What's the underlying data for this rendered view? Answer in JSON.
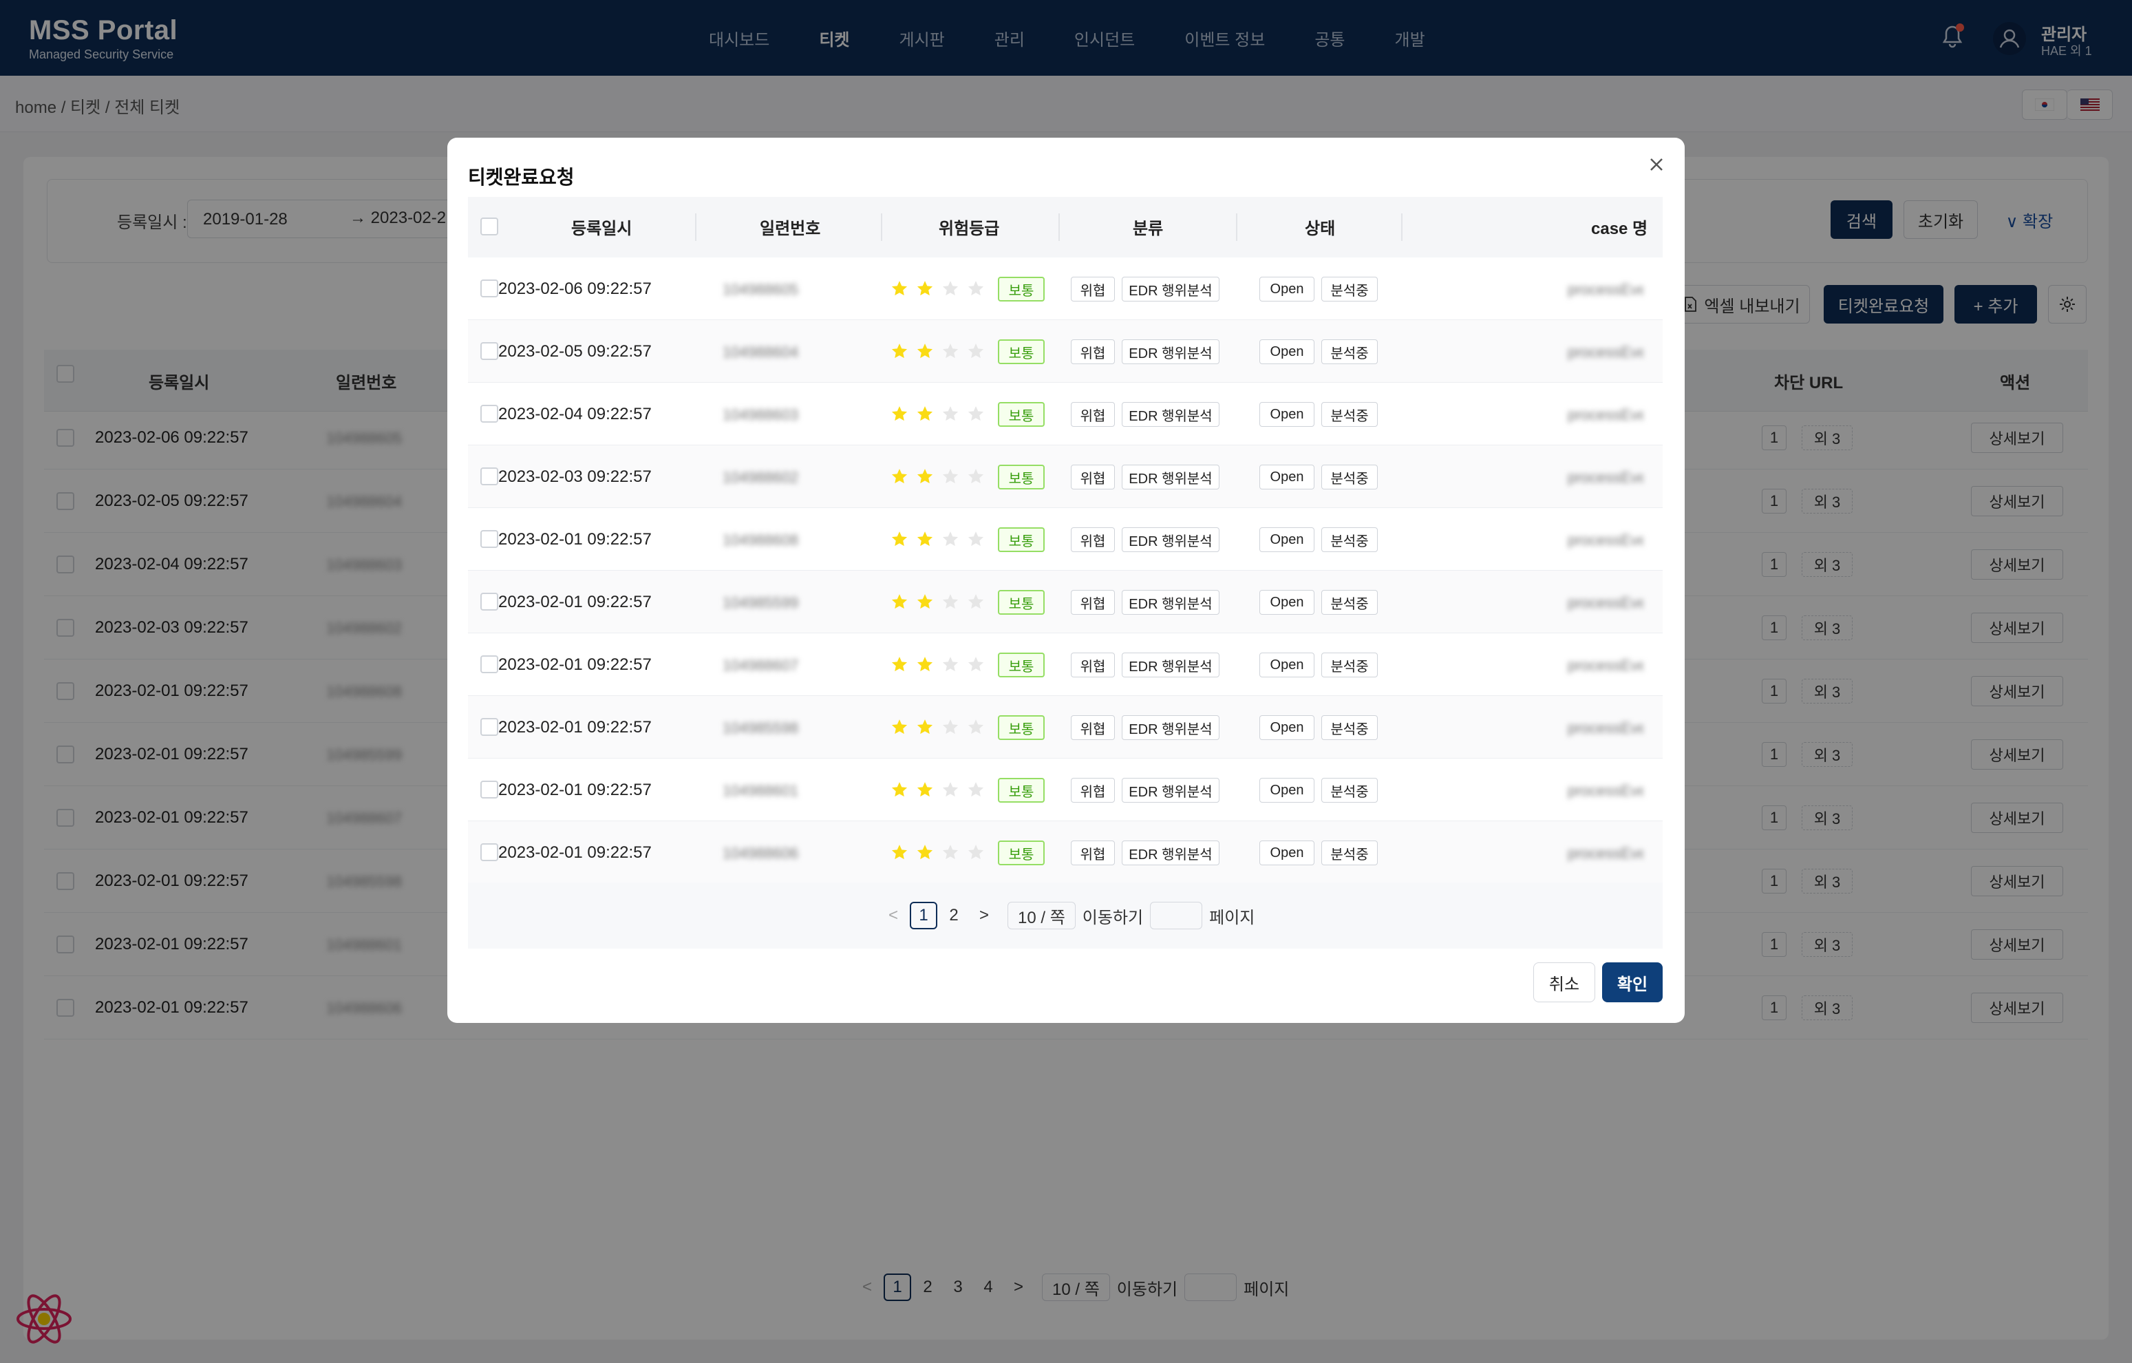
{
  "header": {
    "logo_title": "MSS Portal",
    "logo_sub": "Managed Security Service",
    "nav": [
      "대시보드",
      "티켓",
      "게시판",
      "관리",
      "인시던트",
      "이벤트 정보",
      "공통",
      "개발"
    ],
    "active_nav": "티켓",
    "user_name": "관리자",
    "user_sub": "HAE 외 1"
  },
  "breadcrumb": "home / 티켓 / 전체 티켓",
  "filter": {
    "label": "등록일시 :",
    "date_from": "2019-01-28",
    "date_to": "2023-02-2",
    "search_label": "검색",
    "reset_label": "초기화",
    "expand_label": "∨ 확장"
  },
  "toolbar": {
    "excel_label": "엑셀 내보내기",
    "complete_label": "티켓완료요청",
    "add_label": "+ 추가"
  },
  "table": {
    "headers": {
      "date": "등록일시",
      "serial": "일련번호",
      "block_url": "차단 URL",
      "action": "액션"
    },
    "rows": [
      {
        "date": "2023-02-06 09:22:57",
        "serial": "104988605",
        "url_count": "1",
        "url_more": "외 3",
        "action": "상세보기"
      },
      {
        "date": "2023-02-05 09:22:57",
        "serial": "104988604",
        "url_count": "1",
        "url_more": "외 3",
        "action": "상세보기"
      },
      {
        "date": "2023-02-04 09:22:57",
        "serial": "104988603",
        "url_count": "1",
        "url_more": "외 3",
        "action": "상세보기"
      },
      {
        "date": "2023-02-03 09:22:57",
        "serial": "104988602",
        "url_count": "1",
        "url_more": "외 3",
        "action": "상세보기"
      },
      {
        "date": "2023-02-01 09:22:57",
        "serial": "104988608",
        "url_count": "1",
        "url_more": "외 3",
        "action": "상세보기"
      },
      {
        "date": "2023-02-01 09:22:57",
        "serial": "104985599",
        "url_count": "1",
        "url_more": "외 3",
        "action": "상세보기"
      },
      {
        "date": "2023-02-01 09:22:57",
        "serial": "104988607",
        "url_count": "1",
        "url_more": "외 3",
        "action": "상세보기"
      },
      {
        "date": "2023-02-01 09:22:57",
        "serial": "104985598",
        "url_count": "1",
        "url_more": "외 3",
        "action": "상세보기"
      },
      {
        "date": "2023-02-01 09:22:57",
        "serial": "104988601",
        "url_count": "1",
        "url_more": "외 3",
        "action": "상세보기"
      },
      {
        "date": "2023-02-01 09:22:57",
        "serial": "104988606",
        "url_count": "1",
        "url_more": "외 3",
        "action": "상세보기"
      }
    ]
  },
  "pager": {
    "prev": "<",
    "pages": [
      "1",
      "2",
      "3",
      "4"
    ],
    "next": ">",
    "size": "10 / 쪽",
    "jump_label": "이동하기",
    "page_label": "페이지"
  },
  "modal": {
    "title": "티켓완료요청",
    "headers": {
      "date": "등록일시",
      "serial": "일련번호",
      "risk": "위험등급",
      "category": "분류",
      "status": "상태",
      "case": "case 명"
    },
    "rows": [
      {
        "date": "2023-02-06 09:22:57",
        "serial": "104988605",
        "stars": 2,
        "risk": "보통",
        "cat1": "위협",
        "cat2": "EDR 행위분석",
        "st1": "Open",
        "st2": "분석중",
        "case": "processEvent"
      },
      {
        "date": "2023-02-05 09:22:57",
        "serial": "104988604",
        "stars": 2,
        "risk": "보통",
        "cat1": "위협",
        "cat2": "EDR 행위분석",
        "st1": "Open",
        "st2": "분석중",
        "case": "processEvent"
      },
      {
        "date": "2023-02-04 09:22:57",
        "serial": "104988603",
        "stars": 2,
        "risk": "보통",
        "cat1": "위협",
        "cat2": "EDR 행위분석",
        "st1": "Open",
        "st2": "분석중",
        "case": "processEvent"
      },
      {
        "date": "2023-02-03 09:22:57",
        "serial": "104988602",
        "stars": 2,
        "risk": "보통",
        "cat1": "위협",
        "cat2": "EDR 행위분석",
        "st1": "Open",
        "st2": "분석중",
        "case": "processEvent"
      },
      {
        "date": "2023-02-01 09:22:57",
        "serial": "104988608",
        "stars": 2,
        "risk": "보통",
        "cat1": "위협",
        "cat2": "EDR 행위분석",
        "st1": "Open",
        "st2": "분석중",
        "case": "processEvent"
      },
      {
        "date": "2023-02-01 09:22:57",
        "serial": "104985599",
        "stars": 2,
        "risk": "보통",
        "cat1": "위협",
        "cat2": "EDR 행위분석",
        "st1": "Open",
        "st2": "분석중",
        "case": "processEvent"
      },
      {
        "date": "2023-02-01 09:22:57",
        "serial": "104988607",
        "stars": 2,
        "risk": "보통",
        "cat1": "위협",
        "cat2": "EDR 행위분석",
        "st1": "Open",
        "st2": "분석중",
        "case": "processEvent"
      },
      {
        "date": "2023-02-01 09:22:57",
        "serial": "104985598",
        "stars": 2,
        "risk": "보통",
        "cat1": "위협",
        "cat2": "EDR 행위분석",
        "st1": "Open",
        "st2": "분석중",
        "case": "processEvent"
      },
      {
        "date": "2023-02-01 09:22:57",
        "serial": "104988601",
        "stars": 2,
        "risk": "보통",
        "cat1": "위협",
        "cat2": "EDR 행위분석",
        "st1": "Open",
        "st2": "분석중",
        "case": "processEvent"
      },
      {
        "date": "2023-02-01 09:22:57",
        "serial": "104988606",
        "stars": 2,
        "risk": "보통",
        "cat1": "위협",
        "cat2": "EDR 행위분석",
        "st1": "Open",
        "st2": "분석중",
        "case": "processEvent"
      }
    ],
    "pager": {
      "prev": "<",
      "pages": [
        "1",
        "2"
      ],
      "next": ">",
      "size": "10 / 쪽",
      "jump_label": "이동하기",
      "page_label": "페이지"
    },
    "cancel_label": "취소",
    "ok_label": "확인"
  },
  "colors": {
    "header_bg": "#0e2d57",
    "primary": "#0e2d57",
    "star": "#fadb14",
    "badge_green": "#389e0d"
  },
  "icons": [
    "bell-icon",
    "user-icon",
    "close-icon",
    "star-icon",
    "excel-icon",
    "gear-icon",
    "react-icon"
  ]
}
